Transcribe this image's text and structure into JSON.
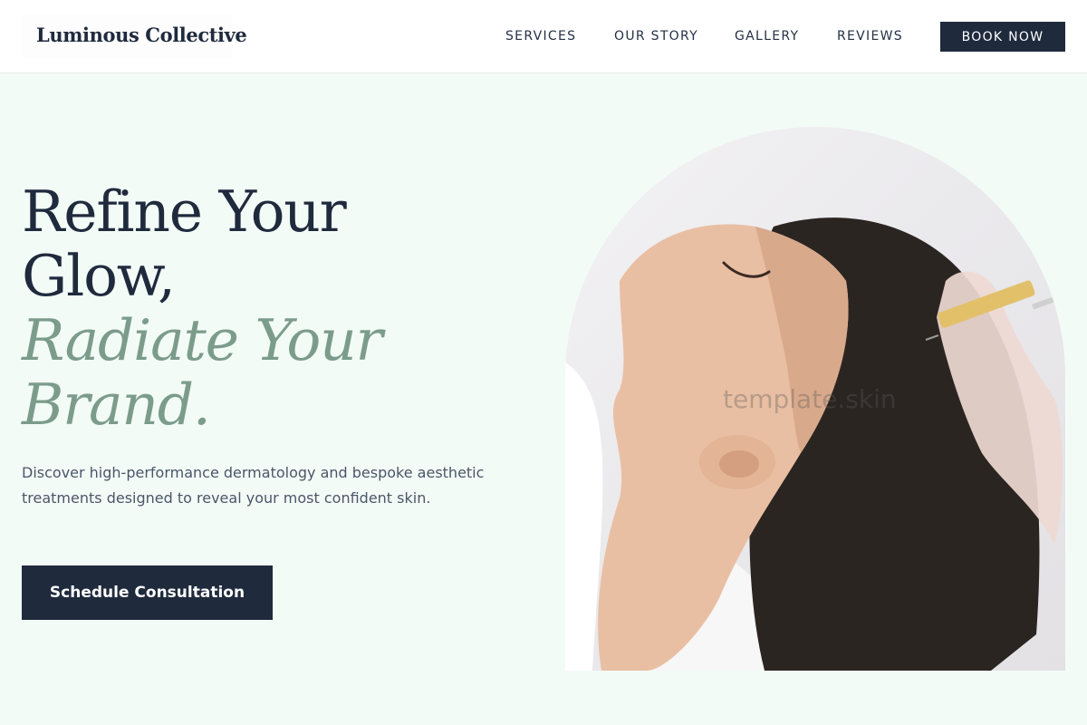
{
  "header": {
    "logo": "Luminous Collective",
    "nav": [
      {
        "label": "SERVICES"
      },
      {
        "label": "OUR STORY"
      },
      {
        "label": "GALLERY"
      },
      {
        "label": "REVIEWS"
      }
    ],
    "book_button": "BOOK NOW"
  },
  "hero": {
    "title_line1": "Refine Your",
    "title_line2": "Glow,",
    "title_accent_line1": "Radiate Your",
    "title_accent_line2": "Brand.",
    "description": "Discover high-performance dermatology and bespoke aesthetic treatments designed to reveal your most confident skin.",
    "cta_label": "Schedule Consultation",
    "watermark": "template.skin"
  },
  "colors": {
    "page_background": "#f3fbf7",
    "primary": "#1f2a3d",
    "accent": "#7c9c8b",
    "body_text": "#4b5668"
  }
}
